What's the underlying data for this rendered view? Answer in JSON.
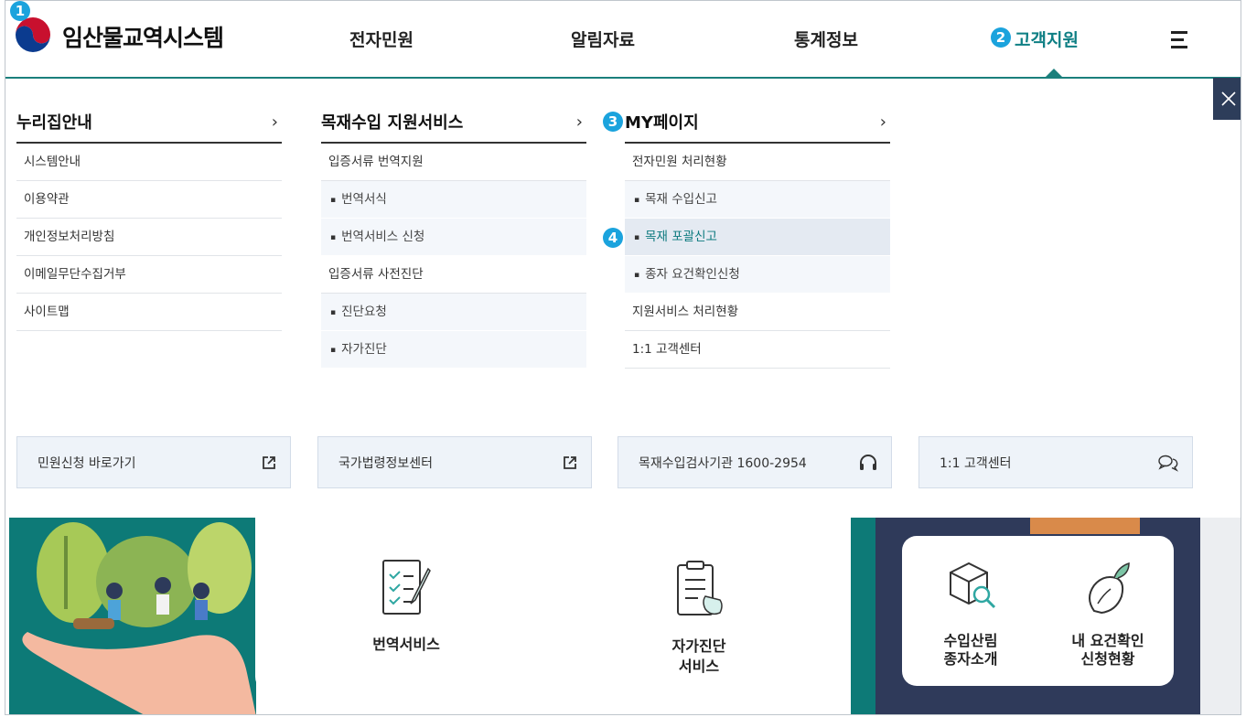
{
  "header": {
    "logo_text": "임산물교역시스템",
    "nav": [
      "전자민원",
      "알림자료",
      "통계정보",
      "고객지원"
    ],
    "badges": [
      "1",
      "2",
      "3",
      "4"
    ]
  },
  "menu": {
    "col1": {
      "title": "누리집안내",
      "items": [
        "시스템안내",
        "이용약관",
        "개인정보처리방침",
        "이메일무단수집거부",
        "사이트맵"
      ]
    },
    "col2": {
      "title": "목재수입 지원서비스",
      "group1": "입증서류 번역지원",
      "group1_subs": [
        "번역서식",
        "번역서비스 신청"
      ],
      "group2": "입증서류 사전진단",
      "group2_subs": [
        "진단요청",
        "자가진단"
      ]
    },
    "col3": {
      "title": "MY페이지",
      "group1": "전자민원 처리현황",
      "group1_subs": [
        "목재 수입신고",
        "목재 포괄신고",
        "종자 요건확인신청"
      ],
      "item2": "지원서비스 처리현황",
      "item3": "1:1 고객센터"
    }
  },
  "quick_links": [
    "민원신청 바로가기",
    "국가법령정보센터",
    "목재수입검사기관 1600-2954",
    "1:1 고객센터"
  ],
  "services": {
    "translate": "번역서비스",
    "selfcheck_l1": "자가진단",
    "selfcheck_l2": "서비스",
    "seed_l1": "수입산림",
    "seed_l2": "종자소개",
    "req_l1": "내 요건확인",
    "req_l2": "신청현황"
  },
  "icons": [
    "close-icon",
    "chevron-right-icon",
    "external-link-icon",
    "headset-icon",
    "chat-icon",
    "hamburger-icon"
  ],
  "colors": {
    "teal": "#0d7a77",
    "navy": "#2f3a5a",
    "badge": "#1ba3dd",
    "active_nav": "#0e7f84"
  }
}
